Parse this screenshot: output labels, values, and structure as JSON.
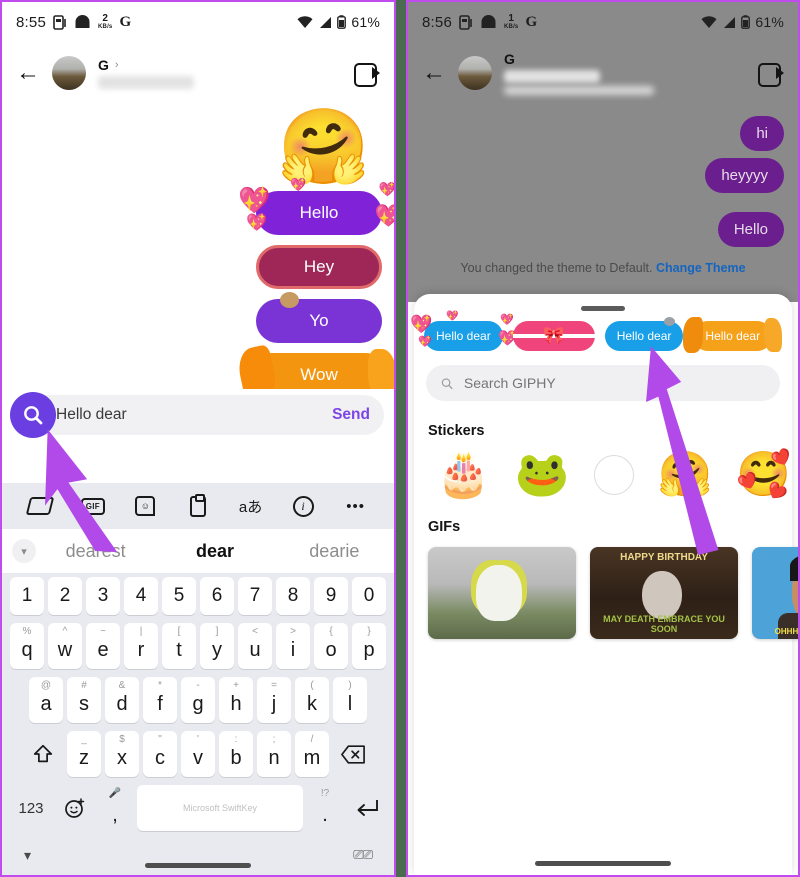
{
  "left_panel": {
    "status_bar": {
      "time": "8:55",
      "net_speed_value": "2",
      "net_speed_unit": "KB/s",
      "g_glyph": "G",
      "battery": "61%"
    },
    "chat_header": {
      "contact_initial": "G",
      "chevron": "›",
      "video_icon": "video-camera"
    },
    "sticker_suggestions": [
      {
        "label": "Hello",
        "style": "purple-hearts"
      },
      {
        "label": "Hey",
        "style": "maroon"
      },
      {
        "label": "Yo",
        "style": "violet"
      },
      {
        "label": "Wow",
        "style": "orange-splat"
      }
    ],
    "big_emoji": "🤗",
    "message_bar": {
      "text": "Hello dear",
      "send_label": "Send",
      "search_icon": "search"
    },
    "keyboard": {
      "toolbar_icons": [
        "roll-icon",
        "gif-icon",
        "sticker-icon",
        "clipboard-icon",
        "translate-icon",
        "info-icon",
        "more-icon"
      ],
      "translate_label": "aあ",
      "more_label": "•••",
      "suggestions": [
        "dearest",
        "dear",
        "dearie"
      ],
      "active_suggestion_index": 1,
      "row_numbers": [
        "1",
        "2",
        "3",
        "4",
        "5",
        "6",
        "7",
        "8",
        "9",
        "0"
      ],
      "row1_keys": [
        "q",
        "w",
        "e",
        "r",
        "t",
        "y",
        "u",
        "i",
        "o",
        "p"
      ],
      "row1_sup": [
        "%",
        "^",
        "~",
        "|",
        "[",
        "]",
        "<",
        ">",
        "{",
        "}"
      ],
      "row2_keys": [
        "a",
        "s",
        "d",
        "f",
        "g",
        "h",
        "j",
        "k",
        "l"
      ],
      "row2_sup": [
        "@",
        "#",
        "&",
        "*",
        "-",
        "+",
        "=",
        "(",
        ")"
      ],
      "row3_keys": [
        "z",
        "x",
        "c",
        "v",
        "b",
        "n",
        "m"
      ],
      "row3_sup": [
        "_",
        "$",
        "\"",
        "'",
        ":",
        ";",
        "/"
      ],
      "shift_icon": "shift-icon",
      "backspace_icon": "backspace-icon",
      "num_label": "123",
      "emoji_icon": "emoji-icon",
      "mic_icon": "mic-icon",
      "comma_label": ",",
      "space_label": "Microsoft SwiftKey",
      "punct_sup": "!?",
      "period_label": ".",
      "enter_icon": "enter-icon",
      "hide_icon": "chevron-down-icon",
      "keyboard_switch_icon": "keyboard-icon"
    }
  },
  "right_panel": {
    "status_bar": {
      "time": "8:56",
      "net_speed_value": "1",
      "net_speed_unit": "KB/s",
      "g_glyph": "G",
      "battery": "61%"
    },
    "chat_header": {
      "contact_initial": "G",
      "chevron": "›",
      "video_icon": "video-camera"
    },
    "messages": [
      {
        "text": "hi",
        "side": "outgoing"
      },
      {
        "text": "heyyyy",
        "side": "outgoing"
      },
      {
        "text": "Hello",
        "side": "outgoing"
      }
    ],
    "theme_note": {
      "text": "You changed the theme to Default.",
      "link": "Change Theme"
    },
    "sheet": {
      "suggestion_chips": [
        {
          "label": "Hello dear",
          "style": "blue-hearts"
        },
        {
          "label": "",
          "style": "pink-gift"
        },
        {
          "label": "Hello dear",
          "style": "blue-plain"
        },
        {
          "label": "Hello dear",
          "style": "orange-splat"
        }
      ],
      "search_placeholder": "Search GIPHY",
      "search_icon": "search-icon",
      "stickers_title": "Stickers",
      "stickers": [
        "🎂",
        "🐸",
        "circle-placeholder",
        "🤗",
        "🥰"
      ],
      "gifs_title": "GIFs",
      "gifs": [
        {
          "caption": "",
          "kind": "mascot-stadium"
        },
        {
          "caption_top": "HAPPY BIRTHDAY",
          "caption_bottom": "MAY DEATH EMBRACE YOU SOON",
          "kind": "goth-birthday"
        },
        {
          "caption": "OHHHH YES! I'M EXCITED!",
          "kind": "excited-person"
        }
      ]
    }
  },
  "colors": {
    "accent_purple": "#7b45e8",
    "search_button": "#6a3ee0",
    "bubble_purple": "#6b1f8e",
    "link_blue": "#1565c0",
    "annotation_arrow": "#b14ae8",
    "frame_border": "#c04cf0"
  }
}
